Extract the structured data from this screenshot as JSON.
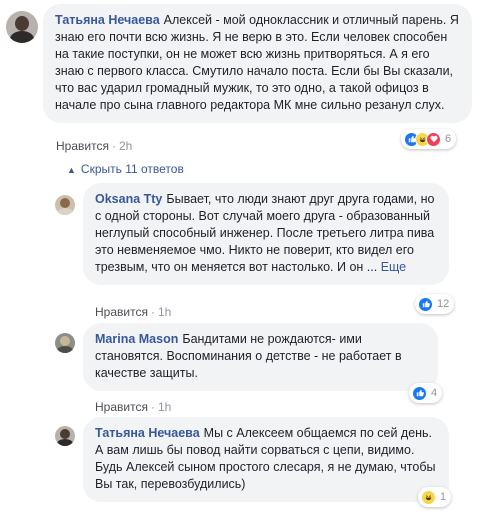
{
  "comments": [
    {
      "author": "Татьяна Нечаева",
      "text": "Алексей - мой одноклассник и отличный парень. Я знаю его почти всю жизнь. Я не верю в это. Если человек способен на такие поступки, он не может всю жизнь притворяться. А я его знаю с первого класса. Смутило начало поста. Если бы Вы сказали, что вас ударил громадный мужик, то это одно, а такой офицоз в начале про сына главного редактора МК мне сильно резанул слух.",
      "like_label": "Нравится",
      "time": "2h",
      "reaction_count": "6",
      "reactions": [
        "like",
        "haha",
        "love"
      ]
    },
    {
      "author": "Oksana Tty",
      "text": "Бывает, что люди знают друг друга годами, но с одной стороны. Вот случай моего друга - образованный неглупый способный инженер. После третьего литра пива это невменяемое чмо. Никто не поверит, кто видел его трезвым, что он меняется вот настолько. И он ...",
      "more_label": "Еще",
      "like_label": "Нравится",
      "time": "1h",
      "reaction_count": "12",
      "reactions": [
        "like"
      ]
    },
    {
      "author": "Marina Mason",
      "text": "Бандитами не рождаются- ими становятся. Воспоминания о детстве - не работает в качестве защиты.",
      "like_label": "Нравится",
      "time": "1h",
      "reaction_count": "4",
      "reactions": [
        "like"
      ]
    },
    {
      "author": "Татьяна Нечаева",
      "text": "Мы с Алексеем общаемся по сей день. А вам лишь бы повод найти сорваться с цепи, видимо. Будь Алексей сыном простого слесаря, я не думаю, чтобы Вы так, перевозбудились)",
      "like_label": "Нравится",
      "time": "1h",
      "reaction_count": "1",
      "reactions": [
        "haha"
      ]
    }
  ],
  "hide_replies_label": "Скрыть 11 ответов",
  "colors": {
    "link": "#385898",
    "bubble": "#f2f3f5",
    "meta": "#90949c"
  }
}
